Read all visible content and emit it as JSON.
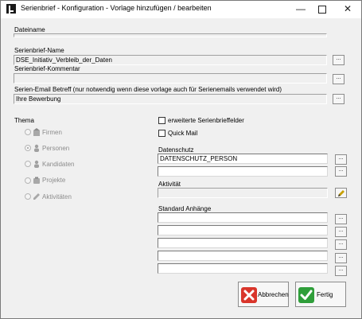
{
  "window": {
    "title": "Serienbrief - Konfiguration - Vorlage hinzufügen / bearbeiten"
  },
  "dateiname": {
    "label": "Dateiname",
    "value": ""
  },
  "serienbrief_name": {
    "label": "Serienbrief-Name",
    "value": "DSE_Initiativ_Verbleib_der_Daten",
    "button": "..."
  },
  "serienbrief_kommentar": {
    "label": "Serienbrief-Kommentar",
    "value": "",
    "button": "..."
  },
  "email_betreff": {
    "label": "Serien-Email Betreff (nur notwendig wenn diese vorlage auch für Serienemails verwendet wird)",
    "value": "Ihre Bewerbung",
    "button": "..."
  },
  "thema": {
    "label": "Thema",
    "options": [
      {
        "label": "Firmen",
        "icon": "building-icon",
        "checked": false
      },
      {
        "label": "Personen",
        "icon": "person-icon",
        "checked": true
      },
      {
        "label": "Kandidaten",
        "icon": "candidate-icon",
        "checked": false
      },
      {
        "label": "Projekte",
        "icon": "project-icon",
        "checked": false
      },
      {
        "label": "Aktivitäten",
        "icon": "activity-icon",
        "checked": false
      }
    ]
  },
  "checkboxes": {
    "erweiterte": {
      "label": "erweiterte Serienbrieffelder",
      "checked": false
    },
    "quickmail": {
      "label": "Quick Mail",
      "checked": false
    }
  },
  "datenschutz": {
    "label": "Datenschutz",
    "values": [
      "DATENSCHUTZ_PERSON",
      ""
    ],
    "button": "..."
  },
  "aktivitaet": {
    "label": "Aktivität",
    "value": "",
    "button_icon": "pencil-icon"
  },
  "standard_anhaenge": {
    "label": "Standard Anhänge",
    "values": [
      "",
      "",
      "",
      "",
      ""
    ],
    "button": "..."
  },
  "buttons": {
    "cancel": {
      "label": "Abbrechen",
      "icon": "red-x-icon",
      "color": "#d9352b"
    },
    "ok": {
      "label": "Fertig",
      "icon": "green-check-icon",
      "color": "#2f9e3a"
    }
  }
}
